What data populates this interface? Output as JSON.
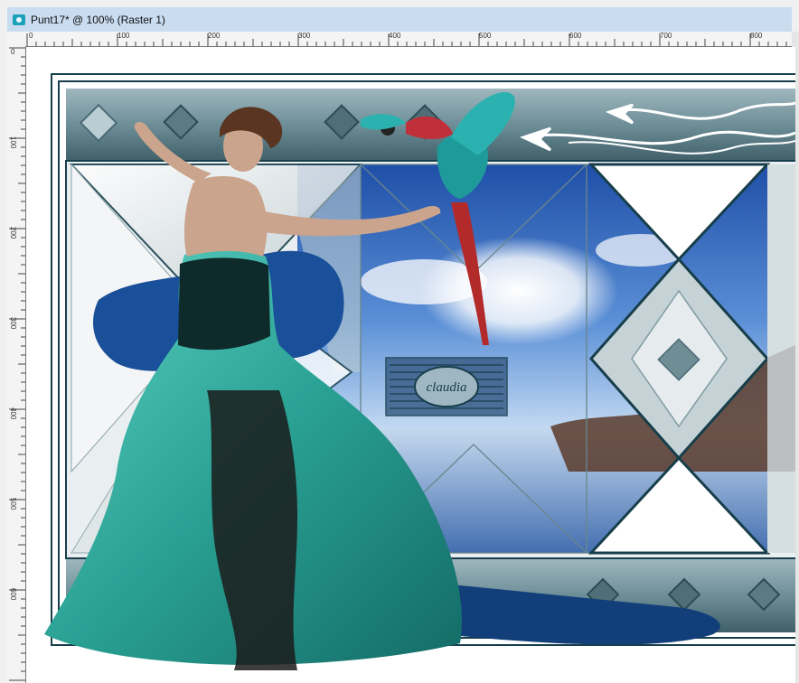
{
  "window": {
    "title": "Punt17* @ 100% (Raster 1)",
    "icon": "paint-shop-icon"
  },
  "ruler_top": {
    "labels": [
      "0",
      "100",
      "200",
      "300",
      "400",
      "500",
      "600",
      "700",
      "800"
    ]
  },
  "ruler_left": {
    "labels": [
      "0",
      "100",
      "200",
      "300",
      "400",
      "500",
      "600"
    ]
  },
  "artwork": {
    "watermark_text": "claudia",
    "colors": {
      "frame_dark": "#173e4a",
      "frame_mid": "#7a9aa3",
      "teal_dress": "#2fa59a",
      "sky_blue": "#2f6fc8",
      "parrot_teal": "#1f9a9a",
      "parrot_red": "#b22a2a"
    }
  }
}
